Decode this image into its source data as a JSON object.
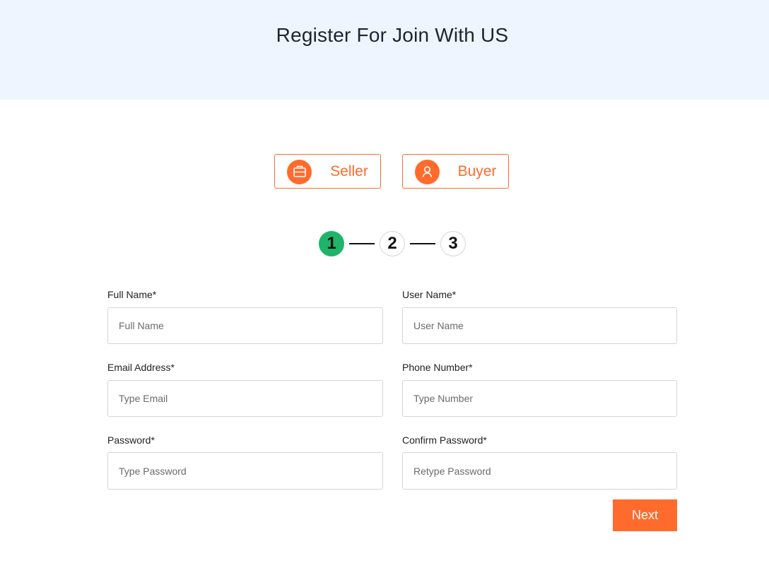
{
  "page": {
    "title": "Register For Join With US"
  },
  "roles": {
    "seller": {
      "label": "Seller",
      "icon": "briefcase-icon"
    },
    "buyer": {
      "label": "Buyer",
      "icon": "user-icon"
    }
  },
  "steps": {
    "items": [
      "1",
      "2",
      "3"
    ],
    "current": "1"
  },
  "form": {
    "full_name": {
      "label": "Full Name*",
      "placeholder": "Full Name",
      "value": ""
    },
    "user_name": {
      "label": "User Name*",
      "placeholder": "User Name",
      "value": ""
    },
    "email": {
      "label": "Email Address*",
      "placeholder": "Type Email",
      "value": ""
    },
    "phone": {
      "label": "Phone Number*",
      "placeholder": "Type Number",
      "value": ""
    },
    "password": {
      "label": "Password*",
      "placeholder": "Type Password",
      "value": ""
    },
    "confirm_password": {
      "label": "Confirm Password*",
      "placeholder": "Retype Password",
      "value": ""
    }
  },
  "actions": {
    "next_label": "Next"
  },
  "colors": {
    "accent": "#ff6b2c",
    "active_step": "#1fb46a",
    "hero_background": "#eff5fe"
  }
}
